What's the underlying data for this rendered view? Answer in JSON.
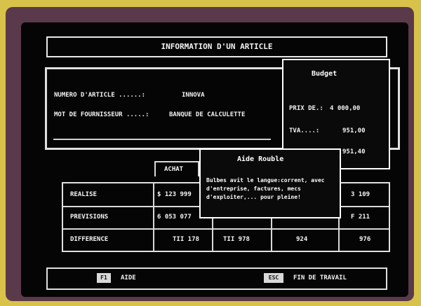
{
  "window": {
    "title": "INFORMATION D'UN ARTICLE"
  },
  "fields": [
    {
      "label": "NUMERO D'ARTICLE ......:",
      "value": "INNOVA"
    },
    {
      "label": "MOT DE FOURNISSEUR .....:",
      "value": "BANQUE DE CALCULETTE"
    }
  ],
  "side_info": {
    "title": "Budget",
    "lines": [
      {
        "label": "PRIX DE.:",
        "value": "4 000,00"
      },
      {
        "label": "TVA....:",
        "value": "951,00"
      },
      {
        "label": "",
        "value": "951,40"
      }
    ]
  },
  "column_header": "ACHAT",
  "table": {
    "rows": [
      {
        "label": "REALISE",
        "cells": [
          "$ 123 999",
          "",
          "",
          "3 109"
        ]
      },
      {
        "label": "PREVISIONS",
        "cells": [
          "6 053 077",
          "",
          "",
          "F 211"
        ]
      },
      {
        "label": "DIFFERENCE",
        "cells": [
          "TII 178",
          "TII 978",
          "924",
          "976"
        ]
      }
    ]
  },
  "popup": {
    "title": "Aide Rouble",
    "text": "Bulbes avit le langue:corrent, avec d'entreprise, factures, mecs d'exploiter,... pour pleine!"
  },
  "footer": {
    "left_key": "F1",
    "left_label": "AIDE",
    "right_key": "ESC",
    "right_label": "FIN DE TRAVAIL"
  }
}
